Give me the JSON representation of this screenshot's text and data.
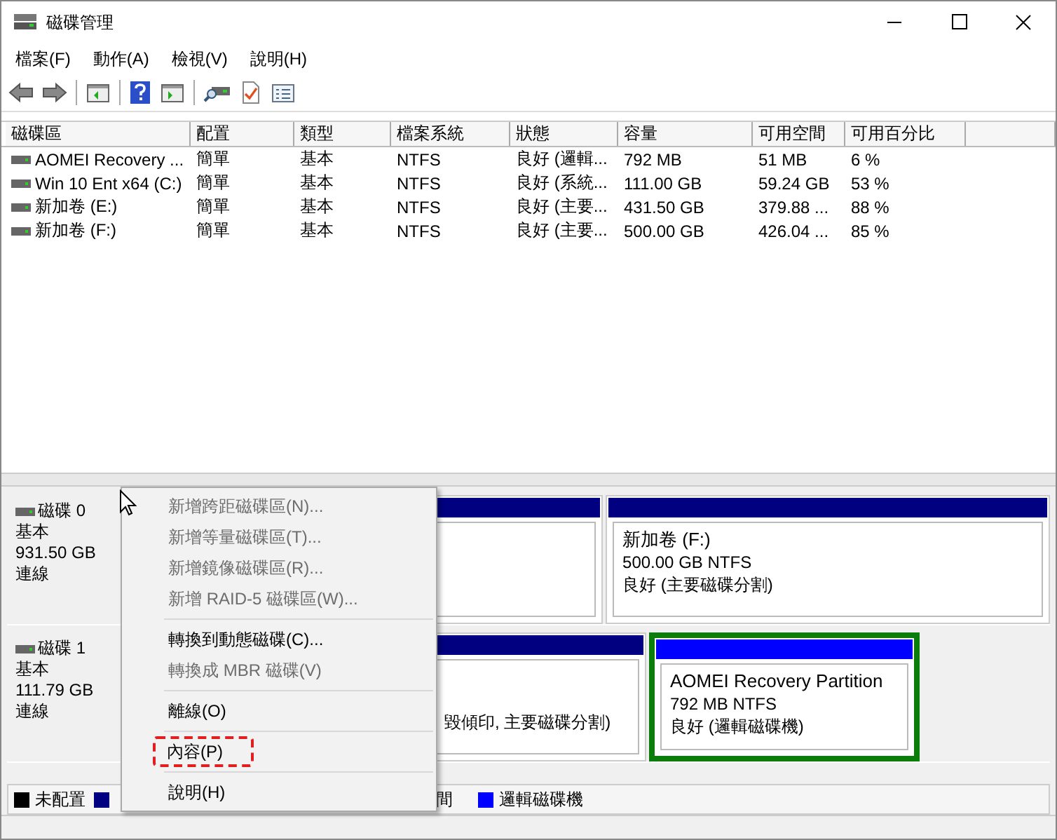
{
  "window": {
    "title": "磁碟管理"
  },
  "menu_bar": [
    "檔案(F)",
    "動作(A)",
    "檢視(V)",
    "說明(H)"
  ],
  "table": {
    "columns": [
      "磁碟區",
      "配置",
      "類型",
      "檔案系統",
      "狀態",
      "容量",
      "可用空間",
      "可用百分比"
    ],
    "rows": [
      [
        "AOMEI Recovery ...",
        "簡單",
        "基本",
        "NTFS",
        "良好 (邏輯...",
        "792 MB",
        "51 MB",
        "6 %"
      ],
      [
        "Win 10 Ent x64 (C:)",
        "簡單",
        "基本",
        "NTFS",
        "良好 (系統...",
        "111.00 GB",
        "59.24 GB",
        "53 %"
      ],
      [
        "新加卷 (E:)",
        "簡單",
        "基本",
        "NTFS",
        "良好 (主要...",
        "431.50 GB",
        "379.88 ...",
        "88 %"
      ],
      [
        "新加卷 (F:)",
        "簡單",
        "基本",
        "NTFS",
        "良好 (主要...",
        "500.00 GB",
        "426.04 ...",
        "85 %"
      ]
    ]
  },
  "disks": [
    {
      "name": "磁碟 0",
      "type": "基本",
      "size": "931.50 GB",
      "status": "連線",
      "partitions": [
        {
          "selected": false,
          "color": "#000080"
        },
        {
          "lines": [
            "新加卷  (F:)",
            "500.00 GB NTFS",
            "良好 (主要磁碟分割)"
          ],
          "selected": false,
          "color": "#000080"
        }
      ]
    },
    {
      "name": "磁碟 1",
      "type": "基本",
      "size": "111.79 GB",
      "status": "連線",
      "partitions": [
        {
          "lines": [
            "毀傾印, 主要磁碟分割)"
          ],
          "selected": false,
          "color": "#000080"
        },
        {
          "lines": [
            "AOMEI Recovery Partition",
            "792 MB NTFS",
            "良好 (邏輯磁碟機)"
          ],
          "selected": true,
          "color": "#0000ff"
        }
      ]
    }
  ],
  "legend": [
    {
      "label": "未配置",
      "color": "#000000"
    },
    {
      "color": "#000080"
    },
    {
      "label": "間"
    },
    {
      "label": "邏輯磁碟機",
      "color": "#0000ff"
    }
  ],
  "context_menu": [
    {
      "kind": "item",
      "label": "新增跨距磁碟區(N)...",
      "disabled": true,
      "highlighted": false
    },
    {
      "kind": "item",
      "label": "新增等量磁碟區(T)...",
      "disabled": true,
      "highlighted": false
    },
    {
      "kind": "item",
      "label": "新增鏡像磁碟區(R)...",
      "disabled": true,
      "highlighted": false
    },
    {
      "kind": "item",
      "label": "新增 RAID-5 磁碟區(W)...",
      "disabled": true,
      "highlighted": false
    },
    {
      "kind": "separator"
    },
    {
      "kind": "item",
      "label": "轉換到動態磁碟(C)...",
      "disabled": false,
      "highlighted": false
    },
    {
      "kind": "item",
      "label": "轉換成 MBR 磁碟(V)",
      "disabled": true,
      "highlighted": false
    },
    {
      "kind": "separator"
    },
    {
      "kind": "item",
      "label": "離線(O)",
      "disabled": false,
      "highlighted": false
    },
    {
      "kind": "separator"
    },
    {
      "kind": "item",
      "label": "內容(P)",
      "disabled": false,
      "highlighted": true
    },
    {
      "kind": "separator"
    },
    {
      "kind": "item",
      "label": "說明(H)",
      "disabled": false,
      "highlighted": false
    }
  ]
}
